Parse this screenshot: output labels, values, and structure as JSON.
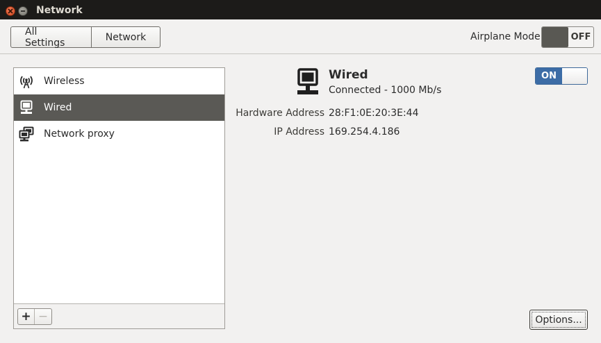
{
  "window": {
    "title": "Network"
  },
  "toolbar": {
    "crumbs": [
      "All Settings",
      "Network"
    ],
    "airplane_label": "Airplane Mode",
    "airplane_state": "OFF"
  },
  "sidebar": {
    "items": [
      {
        "label": "Wireless",
        "icon": "wireless-icon"
      },
      {
        "label": "Wired",
        "icon": "wired-network-icon",
        "selected": true
      },
      {
        "label": "Network proxy",
        "icon": "network-proxy-icon"
      }
    ],
    "add_label": "+",
    "remove_label": "−"
  },
  "device": {
    "name": "Wired",
    "status": "Connected - 1000 Mb/s",
    "switch_state": "ON",
    "hardware_address_label": "Hardware Address",
    "hardware_address": "28:F1:0E:20:3E:44",
    "ip_address_label": "IP Address",
    "ip_address": "169.254.4.186",
    "options_label": "Options..."
  },
  "colors": {
    "titlebar": "#1c1b19",
    "selected_row": "#5a5955",
    "on_switch": "#3c6ca6",
    "close_button": "#e05a30"
  }
}
